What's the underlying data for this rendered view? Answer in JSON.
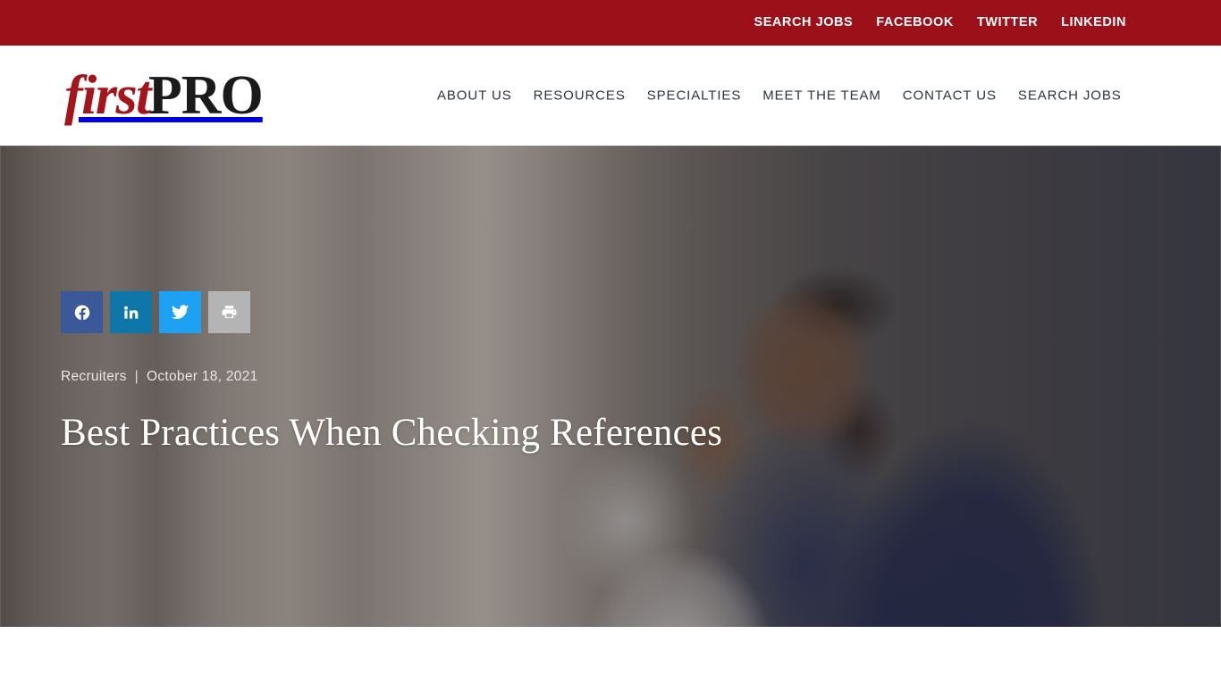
{
  "topbar": {
    "background_color": "#9b1019",
    "links": [
      {
        "label": "SEARCH JOBS",
        "name": "topbar-link-search-jobs"
      },
      {
        "label": "FACEBOOK",
        "name": "topbar-link-facebook"
      },
      {
        "label": "TWITTER",
        "name": "topbar-link-twitter"
      },
      {
        "label": "LINKEDIN",
        "name": "topbar-link-linkedin"
      }
    ]
  },
  "header": {
    "logo": {
      "first": "first",
      "pro": "PRO",
      "first_color": "#a4141b",
      "pro_color": "#1a1a1a"
    },
    "nav": [
      {
        "label": "ABOUT US"
      },
      {
        "label": "RESOURCES"
      },
      {
        "label": "SPECIALTIES"
      },
      {
        "label": "MEET THE TEAM"
      },
      {
        "label": "CONTACT US"
      },
      {
        "label": "SEARCH JOBS"
      }
    ]
  },
  "hero": {
    "share": [
      {
        "icon": "facebook-icon",
        "label": "Share on Facebook",
        "color": "#3b5998"
      },
      {
        "icon": "linkedin-icon",
        "label": "Share on LinkedIn",
        "color": "#0e76a8"
      },
      {
        "icon": "twitter-icon",
        "label": "Share on Twitter",
        "color": "#1da1f2"
      },
      {
        "icon": "print-icon",
        "label": "Print this page",
        "color": "#b4b4b4"
      }
    ],
    "category": "Recruiters",
    "separator": "|",
    "date": "October 18, 2021",
    "title": "Best Practices When Checking References"
  }
}
